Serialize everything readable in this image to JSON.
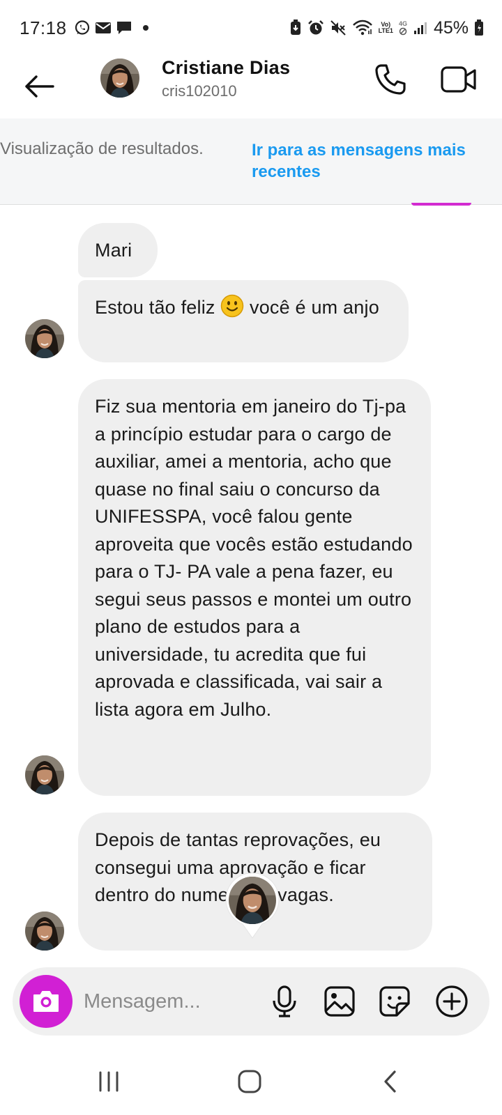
{
  "status_bar": {
    "time": "17:18",
    "notification_icons": [
      "whatsapp-icon",
      "mail-icon",
      "message-icon",
      "dot-icon"
    ],
    "system_icons": [
      "battery-saver-icon",
      "alarm-icon",
      "mute-icon",
      "wifi-icon",
      "volte-icon",
      "4g-icon",
      "signal-icon"
    ],
    "volte_line1": "Vo)",
    "volte_line2": "LTE1",
    "network_label": "4G",
    "battery": "45%"
  },
  "header": {
    "contact_name": "Cristiane Dias",
    "username": "cris102010",
    "icons": [
      "back-arrow-icon",
      "phone-icon",
      "video-camera-icon"
    ]
  },
  "banner": {
    "text": "Visualização de resultados.",
    "link": "Ir para as mensagens mais recentes"
  },
  "messages": [
    {
      "text": "Mari"
    },
    {
      "text_before_emoji": "Estou tão feliz",
      "emoji": "slightly-smiling-face",
      "text_after_emoji": "você é um anjo"
    },
    {
      "text": "Fiz sua mentoria em janeiro do Tj-pa a princípio estudar para o cargo de auxiliar, amei a mentoria, acho que quase no final saiu o concurso da UNIFESSPA, você falou gente aproveita que vocês estão estudando para o TJ- PA vale a pena fazer, eu segui seus passos e montei um outro plano de estudos para a universidade, tu acredita que fui aprovada e classificada, vai sair a lista agora em Julho."
    },
    {
      "text": "Depois de tantas reprovações, eu consegui uma aprovação e ficar dentro do numero de vagas."
    }
  ],
  "composer": {
    "placeholder": "Mensagem...",
    "icons": [
      "camera-icon",
      "microphone-icon",
      "gallery-icon",
      "sticker-icon",
      "plus-circle-icon"
    ]
  },
  "colors": {
    "accent_link": "#1a9af0",
    "camera_button": "#d120d4",
    "bubble": "#efefef",
    "banner_bg": "#f5f6f7"
  }
}
